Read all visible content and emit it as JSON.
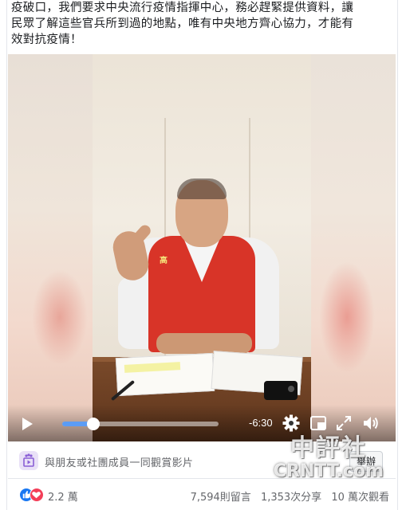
{
  "post": {
    "lines": [
      "疫破口，我們要求中央流行疫情指揮中心，務必趕緊提供資料，讓",
      "民眾了解這些官兵所到過的地點，唯有中央地方齊心協力，才能有",
      "效對抗疫情！"
    ]
  },
  "video": {
    "time_remaining": "-6:30",
    "progress": 0.2,
    "vest_badge": "高",
    "icons": {
      "play": "play-icon",
      "settings": "gear-icon",
      "pip": "picture-in-picture-icon",
      "fullscreen": "fullscreen-icon",
      "volume": "volume-icon"
    }
  },
  "watch_party": {
    "text": "與朋友或社團成員一同觀賞影片",
    "button": "舉辦"
  },
  "stats": {
    "reactions": "2.2 萬",
    "comments": "7,594則留言",
    "shares": "1,353次分享",
    "views": "10 萬次觀看"
  },
  "watermark": {
    "cn": "中評社",
    "en": "CRNTT.com"
  },
  "colors": {
    "progress": "#5b9cf5",
    "like": "#1877f2",
    "love": "#f33e58",
    "vest": "#d83428"
  }
}
